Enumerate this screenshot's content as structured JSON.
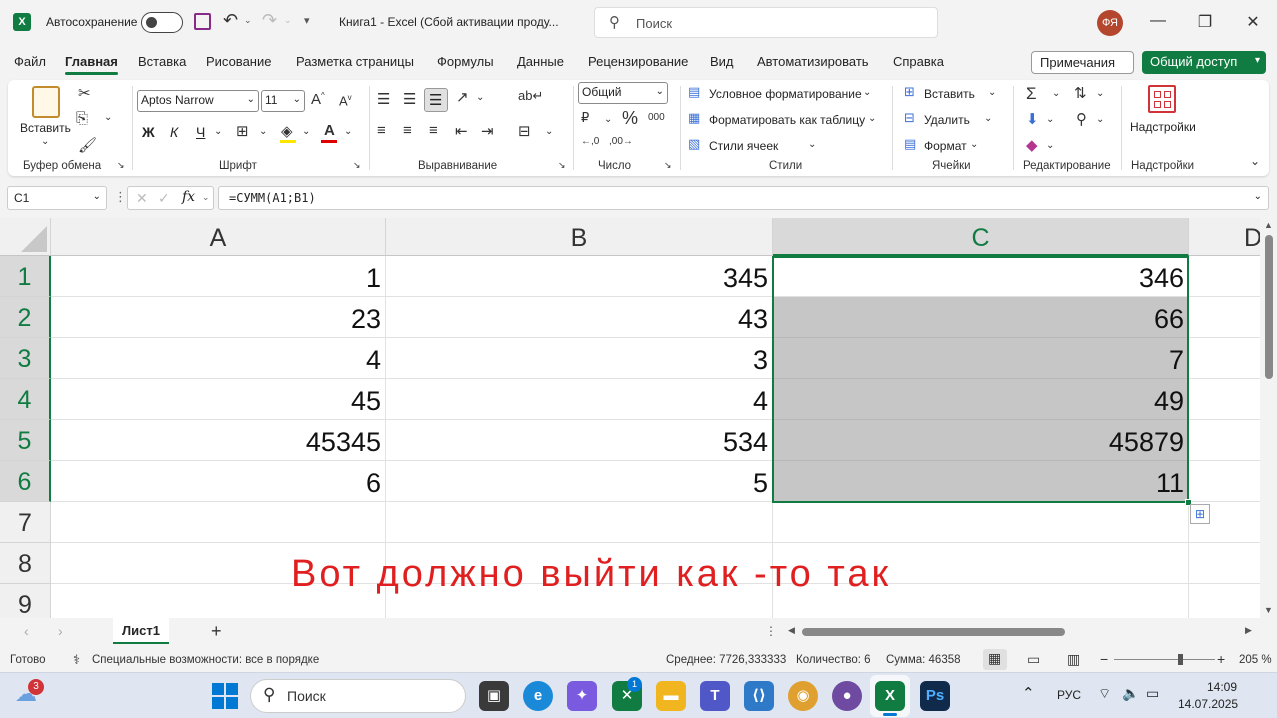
{
  "titlebar": {
    "autosave_label": "Автосохранение",
    "doc_title": "Книга1  -  Excel (Сбой активации проду...",
    "search_placeholder": "Поиск",
    "user_initials": "ФЯ"
  },
  "tabs": [
    "Файл",
    "Главная",
    "Вставка",
    "Рисование",
    "Разметка страницы",
    "Формулы",
    "Данные",
    "Рецензирование",
    "Вид",
    "Автоматизировать",
    "Справка"
  ],
  "active_tab": "Главная",
  "header_buttons": {
    "notes": "Примечания",
    "share": "Общий доступ"
  },
  "ribbon": {
    "clipboard": {
      "paste": "Вставить",
      "group": "Буфер обмена"
    },
    "font": {
      "name": "Aptos Narrow",
      "size": "11",
      "bold": "Ж",
      "italic": "К",
      "underline": "Ч",
      "group": "Шрифт"
    },
    "alignment": {
      "group": "Выравнивание"
    },
    "number": {
      "format": "Общий",
      "group": "Число"
    },
    "styles": {
      "conditional": "Условное форматирование",
      "as_table": "Форматировать как таблицу",
      "cell_styles": "Стили ячеек",
      "group": "Стили"
    },
    "cells": {
      "insert": "Вставить",
      "delete": "Удалить",
      "format": "Формат",
      "group": "Ячейки"
    },
    "editing": {
      "group": "Редактирование"
    },
    "addins": {
      "label": "Надстройки",
      "group": "Надстройки"
    }
  },
  "formula_bar": {
    "name_box": "C1",
    "fx": "fx",
    "formula": "=СУММ(A1;B1)"
  },
  "grid": {
    "columns": [
      "A",
      "B",
      "C",
      "D"
    ],
    "selected_column": "C",
    "rows": [
      "1",
      "2",
      "3",
      "4",
      "5",
      "6",
      "7",
      "8",
      "9"
    ],
    "cells": [
      [
        "1",
        "345",
        "346"
      ],
      [
        "23",
        "43",
        "66"
      ],
      [
        "4",
        "3",
        "7"
      ],
      [
        "45",
        "4",
        "49"
      ],
      [
        "45345",
        "534",
        "45879"
      ],
      [
        "6",
        "5",
        "11"
      ]
    ]
  },
  "annotation_text": "Вот должно выйти как -то так",
  "sheet_tab": "Лист1",
  "statusbar": {
    "ready": "Готово",
    "accessibility": "Специальные возможности: все в порядке",
    "average": "Среднее: 7726,333333",
    "count": "Количество: 6",
    "sum": "Сумма: 46358",
    "zoom": "205 %"
  },
  "taskbar": {
    "search": "Поиск",
    "weather_badge": "3",
    "notif_badge": "1",
    "lang": "РУС",
    "time": "14:09",
    "date": "14.07.2025"
  },
  "colors": {
    "accent": "#107c41",
    "selection_fill": "#c6c6c6",
    "annotation": "#e02020"
  }
}
